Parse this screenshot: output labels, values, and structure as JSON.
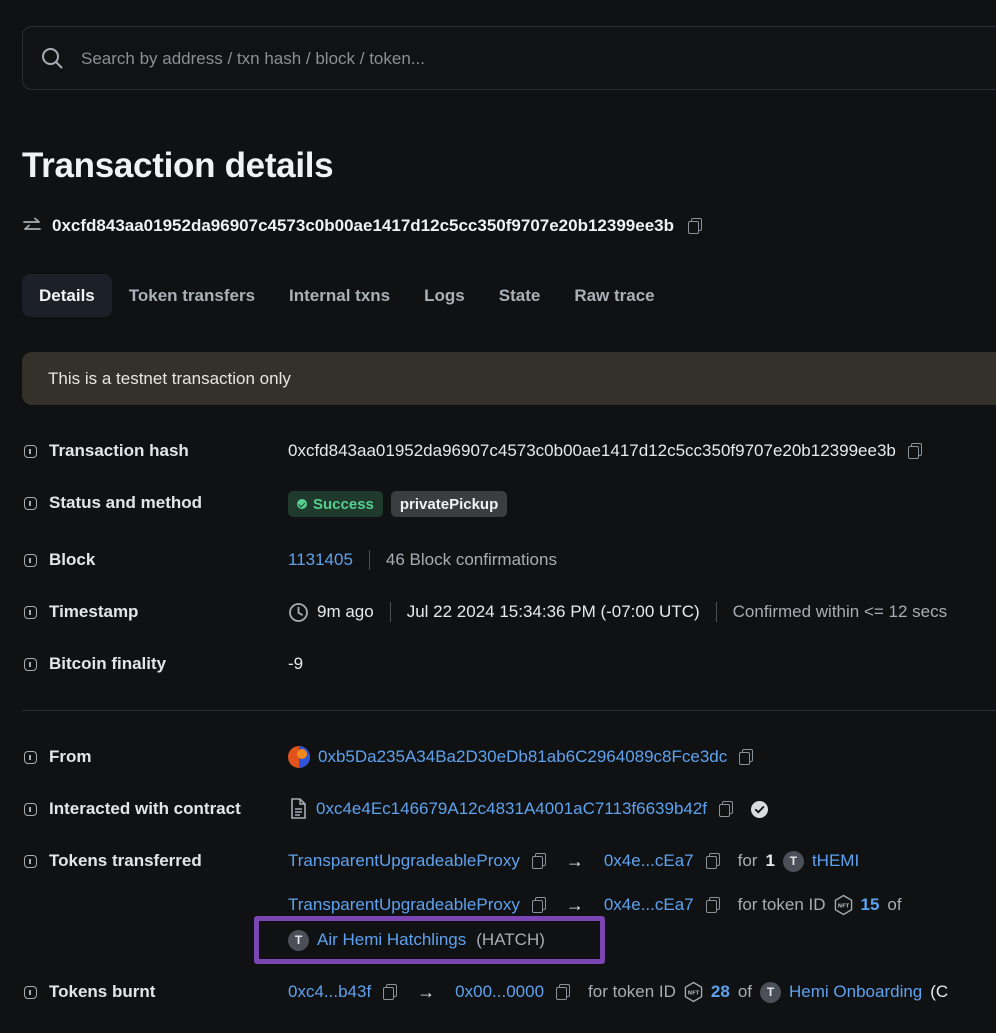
{
  "search": {
    "placeholder": "Search by address / txn hash / block / token..."
  },
  "page_title": "Transaction details",
  "tx_hash_header": "0xcfd843aa01952da96907c4573c0b00ae1417d12c5cc350f9707e20b12399ee3b",
  "tabs": [
    {
      "label": "Details",
      "active": true
    },
    {
      "label": "Token transfers"
    },
    {
      "label": "Internal txns"
    },
    {
      "label": "Logs"
    },
    {
      "label": "State"
    },
    {
      "label": "Raw trace"
    }
  ],
  "banner": "This is a testnet transaction only",
  "labels": {
    "tx_hash": "Transaction hash",
    "status": "Status and method",
    "block": "Block",
    "timestamp": "Timestamp",
    "bitcoin_finality": "Bitcoin finality",
    "from": "From",
    "interacted": "Interacted with contract",
    "tokens_transferred": "Tokens transferred",
    "tokens_burnt": "Tokens burnt"
  },
  "values": {
    "tx_hash": "0xcfd843aa01952da96907c4573c0b00ae1417d12c5cc350f9707e20b12399ee3b",
    "status": "Success",
    "method": "privatePickup",
    "block_number": "1131405",
    "block_confirmations": "46 Block confirmations",
    "time_ago": "9m ago",
    "timestamp": "Jul 22 2024 15:34:36 PM (-07:00 UTC)",
    "confirmed_within": "Confirmed within <= 12 secs",
    "bitcoin_finality": "-9",
    "from_address": "0xb5Da235A34Ba2D30eDb81ab6C2964089c8Fce3dc",
    "contract_address": "0xc4e4Ec146679A12c4831A4001aC7113f6639b42f"
  },
  "transfers": [
    {
      "from": "TransparentUpgradeableProxy",
      "to": "0x4e...cEa7",
      "for_text": "for",
      "amount": "1",
      "token_icon": "T",
      "token": "tHEMI"
    },
    {
      "from": "TransparentUpgradeableProxy",
      "to": "0x4e...cEa7",
      "for_text": "for token ID",
      "nft_icon": "NFT",
      "token_id": "15",
      "of_text": "of",
      "token_icon": "T",
      "token": "Air Hemi Hatchlings",
      "symbol": "(HATCH)"
    }
  ],
  "burnt": {
    "from": "0xc4...b43f",
    "to": "0x00...0000",
    "for_text": "for token ID",
    "nft_icon": "NFT",
    "token_id": "28",
    "of_text": "of",
    "token_icon": "T",
    "token": "Hemi Onboarding",
    "symbol_partial": "(C"
  },
  "colors": {
    "background": "#101112",
    "link": "#5ea2ef",
    "success": "#56cf8e",
    "banner": "#34302a",
    "highlight": "#7c45b4"
  }
}
